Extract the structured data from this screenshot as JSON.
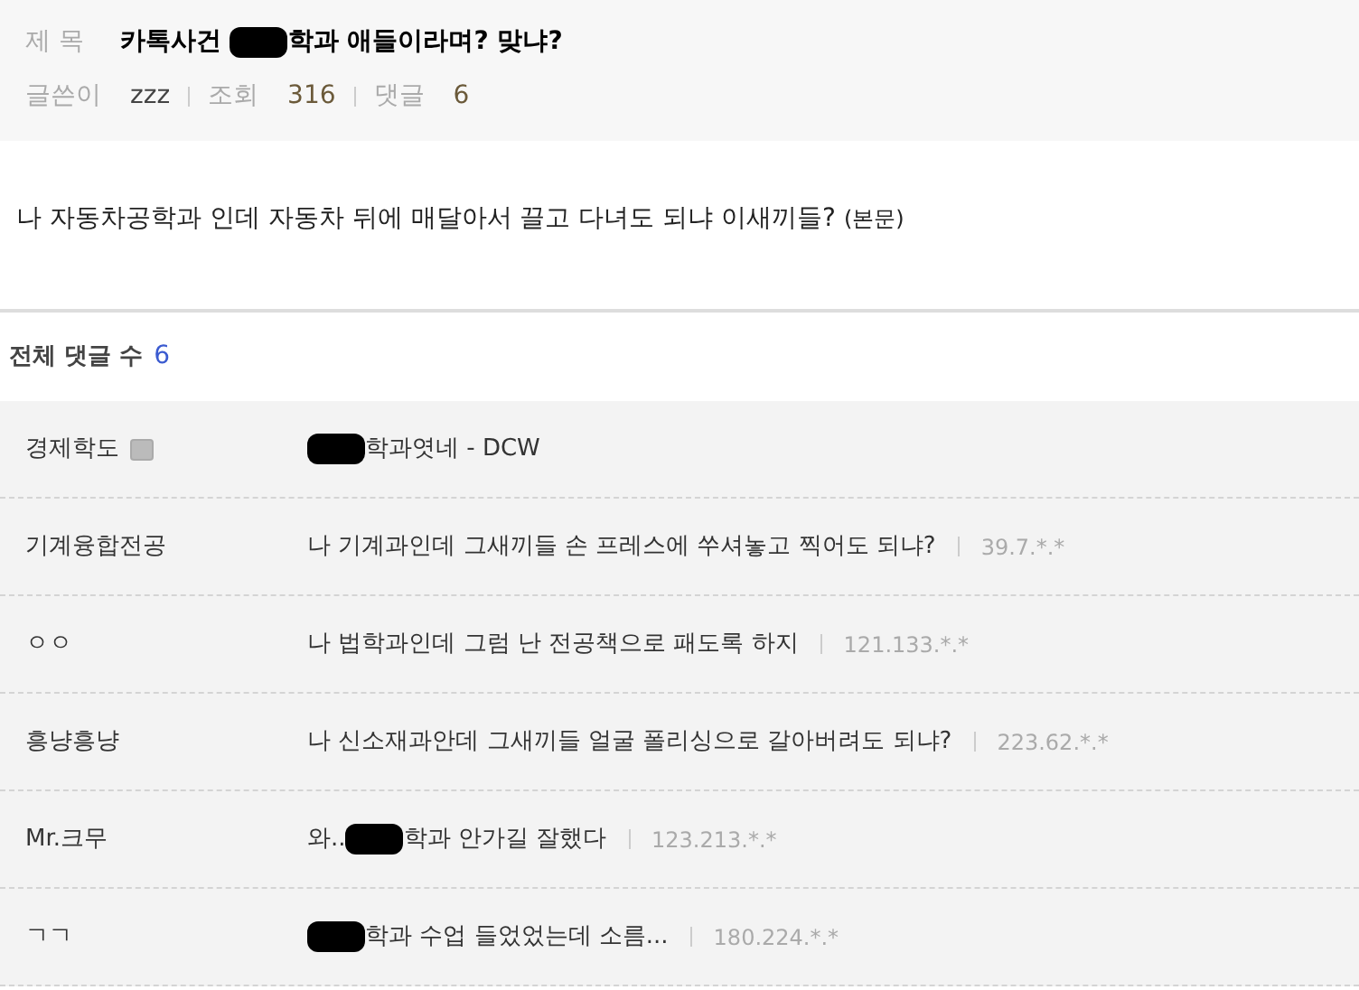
{
  "post": {
    "title_label": "제 목",
    "title": [
      {
        "kind": "text",
        "text": "카톡사건 "
      },
      {
        "kind": "redacted"
      },
      {
        "kind": "text",
        "text": "학과 애들이라며? 맞냐?"
      }
    ],
    "meta": [
      {
        "label": "글쓴이",
        "value": "zzz"
      },
      {
        "label": "조회",
        "value": "316"
      },
      {
        "label": "댓글",
        "value": "6"
      }
    ],
    "body": "나 자동차공학과 인데 자동차 뒤에 매달아서 끌고 다녀도 되냐 이새끼들?",
    "body_suffix": "(본문)"
  },
  "comments_header": {
    "label": "전체 댓글 수",
    "count": "6"
  },
  "comments": [
    {
      "author": "경제학도",
      "has_badge": true,
      "content": [
        {
          "kind": "redacted"
        },
        {
          "kind": "text",
          "text": "학과엿네 - DCW"
        }
      ]
    },
    {
      "author": "기계융합전공",
      "has_badge": false,
      "content": [
        {
          "kind": "text",
          "text": "나 기계과인데 그새끼들 손 프레스에 쑤셔놓고 찍어도 되냐?"
        }
      ],
      "ip": "39.7.*.*"
    },
    {
      "author": "ㅇㅇ",
      "has_badge": false,
      "content": [
        {
          "kind": "text",
          "text": "나 법학과인데 그럼 난 전공책으로 패도록 하지"
        }
      ],
      "ip": "121.133.*.*"
    },
    {
      "author": "흥냥흥냥",
      "has_badge": false,
      "content": [
        {
          "kind": "text",
          "text": "나 신소재과안데 그새끼들 얼굴 폴리싱으로 갈아버려도 되냐?"
        }
      ],
      "ip": "223.62.*.*"
    },
    {
      "author": "Mr.크무",
      "has_badge": false,
      "content": [
        {
          "kind": "text",
          "text": "와.."
        },
        {
          "kind": "redacted"
        },
        {
          "kind": "text",
          "text": "학과 안가길 잘했다"
        }
      ],
      "ip": "123.213.*.*"
    },
    {
      "author": "ㄱㄱ",
      "has_badge": false,
      "content": [
        {
          "kind": "redacted"
        },
        {
          "kind": "text",
          "text": "학과 수업 들었었는데 소름..."
        }
      ],
      "ip": "180.224.*.*"
    }
  ]
}
